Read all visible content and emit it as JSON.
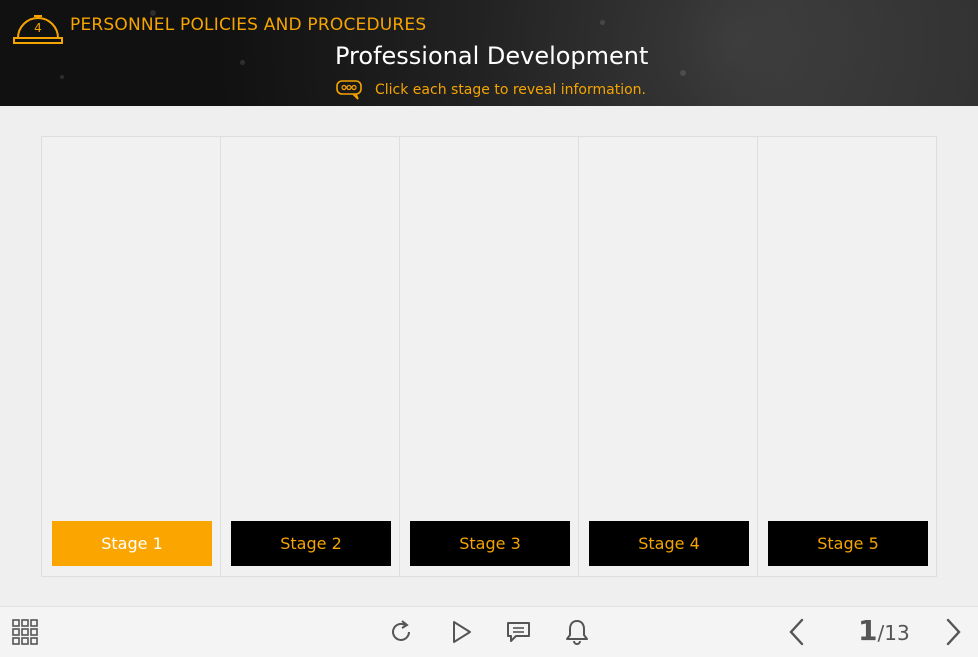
{
  "header": {
    "module_number": "4",
    "module_title": "PERSONNEL POLICIES AND PROCEDURES",
    "page_title": "Professional Development",
    "hint": "Click each stage to reveal information.",
    "accent_color": "#f5a400"
  },
  "stages": [
    {
      "label": "Stage 1",
      "active": true
    },
    {
      "label": "Stage 2",
      "active": false
    },
    {
      "label": "Stage 3",
      "active": false
    },
    {
      "label": "Stage 4",
      "active": false
    },
    {
      "label": "Stage 5",
      "active": false
    }
  ],
  "footer": {
    "icons": [
      "grid-menu-icon",
      "replay-icon",
      "play-icon",
      "transcript-icon",
      "notification-bell-icon",
      "previous-icon",
      "next-icon"
    ],
    "page_current": "1",
    "page_total": "/13"
  }
}
